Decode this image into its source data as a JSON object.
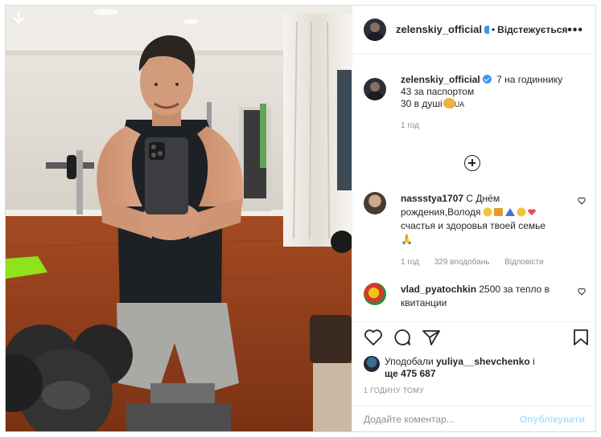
{
  "post": {
    "username": "zelenskiy_official",
    "follow_label": "Відстежується",
    "more_icon": "more-horizontal-icon",
    "caption": {
      "intro": "7 на годиннику",
      "line2": "43 за паспортом",
      "line3": "30 в душі",
      "line3_suffix": "UA",
      "time": "1 год"
    },
    "comments": [
      {
        "username": "nassstya1707",
        "text_line1": "С Днём",
        "text_line2": "рождения,Володя",
        "text_line3": "счастья и здоровья твоей семье",
        "emoji_tail": "🙏",
        "time": "1 год",
        "likes": "329 вподобань",
        "reply": "Відповісти"
      },
      {
        "username": "vlad_pyatochkin",
        "text": "2500 за тепло в квитанции"
      }
    ],
    "liked_by": {
      "prefix": "Уподобали",
      "user": "yuliya__shevchenko",
      "mid": "і",
      "and_word": "ще",
      "count": "475 687"
    },
    "posted_ago": "1 ГОДИНУ ТОМУ",
    "comment_input": {
      "placeholder": "Додайте коментар...",
      "publish_label": "Опублікувати"
    }
  },
  "colors": {
    "verified": "#3897f0",
    "muted": "#8e8e8e",
    "publish_disabled": "#b2dffc",
    "heart_emoji": "#ed4956"
  }
}
